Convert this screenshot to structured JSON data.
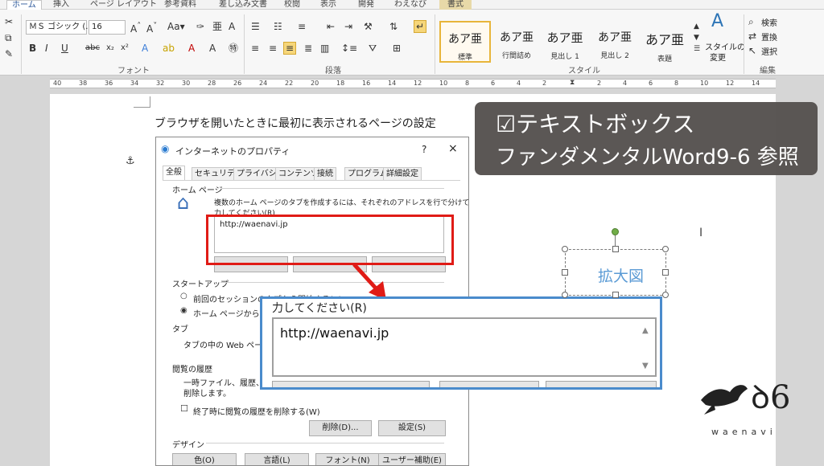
{
  "ribbon": {
    "tabs": [
      "ホーム",
      "挿入",
      "ページ レイアウト",
      "参考資料",
      "差し込み文書",
      "校閲",
      "表示",
      "開発",
      "わえなび",
      "書式"
    ],
    "font_name": "ＭＳ ゴシック (...",
    "font_size": "16",
    "groups": [
      "フォント",
      "段落",
      "スタイル",
      "編集"
    ],
    "styles": [
      {
        "sample": "あア亜",
        "label": "標準"
      },
      {
        "sample": "あア亜",
        "label": "行間詰め"
      },
      {
        "sample": "あア亜",
        "label": "見出し 1"
      },
      {
        "sample": "あア亜",
        "label": "見出し 2"
      },
      {
        "sample": "あア亜",
        "label": "表題"
      }
    ],
    "style_change_1": "スタイルの",
    "style_change_2": "変更",
    "search": "検索",
    "replace": "置換",
    "select": "選択"
  },
  "ruler": [
    "40",
    "38",
    "36",
    "34",
    "32",
    "30",
    "28",
    "26",
    "24",
    "22",
    "20",
    "18",
    "16",
    "14",
    "12",
    "10",
    "8",
    "6",
    "4",
    "2",
    "2",
    "4",
    "6",
    "8",
    "10",
    "12",
    "14"
  ],
  "document": {
    "body_text": "ブラウザを開いたときに最初に表示されるページの設定"
  },
  "dialog": {
    "title": "インターネットのプロパティ",
    "help": "?",
    "close": "×",
    "tabs": [
      "全般",
      "セキュリティ",
      "プライバシー",
      "コンテンツ",
      "接続",
      "プログラム",
      "詳細設定"
    ],
    "homepage_section": "ホーム ページ",
    "homepage_desc_1": "複数のホーム ページのタブを作成するには、それぞれのアドレスを行で分けて入",
    "homepage_desc_2": "力してください(R)",
    "homepage_value": "http://waenavi.jp",
    "startup_section": "スタートアップ",
    "startup_option1": "前回のセッションのタブから開始する(B)",
    "startup_option2": "ホーム ページから開始する(H)",
    "tabs_section": "タブ",
    "tabs_desc": "タブの中の Web ページの",
    "history_section": "閲覧の履歴",
    "history_desc_1": "一時ファイル、履歴、Coo",
    "history_desc_2": "削除します。",
    "delete_on_exit": "終了時に閲覧の履歴を削除する(W)",
    "delete_button": "削除(D)...",
    "settings_button": "設定(S)",
    "design_section": "デザイン",
    "design_buttons": [
      "色(O)",
      "言語(L)",
      "フォント(N)",
      "ユーザー補助(E)"
    ]
  },
  "zoom": {
    "label": "力してください(R)",
    "value": "http://waenavi.jp"
  },
  "shape_text": "拡大図",
  "callout": {
    "line1": "☑テキストボックス",
    "line2": "ファンダメンタルWord9-6 参照"
  },
  "logo_text": "waenavi",
  "colors": {
    "red_highlight": "#e01b16",
    "blue_zoom": "#4a8bcc",
    "shape_text": "#5b9bd5",
    "callout_bg": "#54504e",
    "rotation_handle": "#70ad47"
  }
}
